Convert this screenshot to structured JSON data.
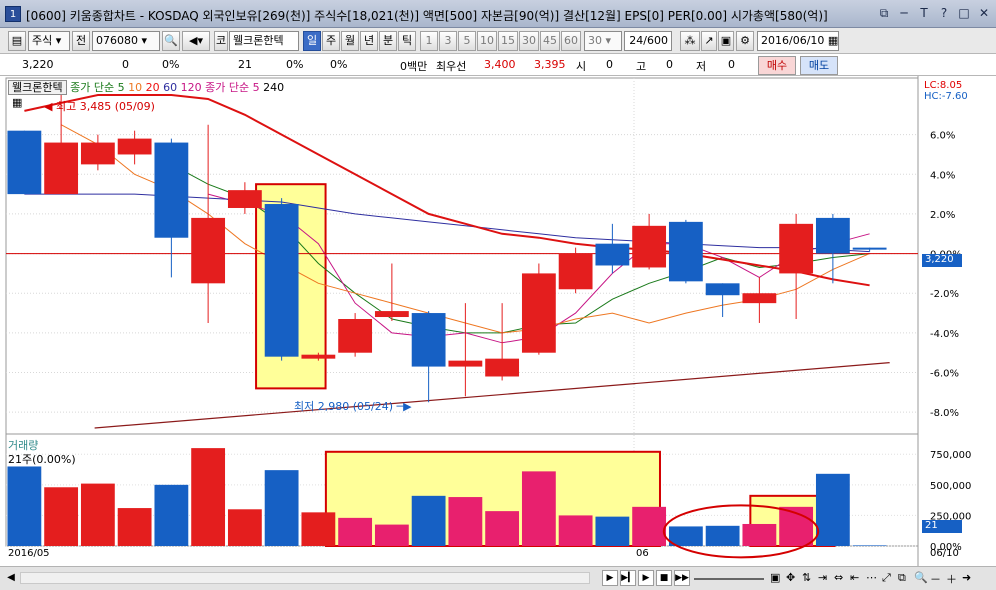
{
  "window": {
    "icon_label": "1",
    "title": "[0600] 키움종합차트 - KOSDAQ 외국인보유[269(천)] 주식수[18,021(천)] 액면[500] 자본금[90(억)] 결산[12월] EPS[0] PER[0.00] 시가총액[580(억)]",
    "sys_icons": [
      "⧉",
      "─",
      "T",
      "?",
      "□",
      "✕"
    ]
  },
  "toolbar": {
    "market": "주식",
    "prev": "전",
    "code": "076080",
    "stock_prefix": "코",
    "stock_name": "웰크론한텍",
    "periods": [
      "일",
      "주",
      "월",
      "년",
      "분",
      "틱"
    ],
    "active_period": "일",
    "minute_options": [
      "1",
      "3",
      "5",
      "10",
      "15",
      "30",
      "45",
      "60"
    ],
    "count_value": "30",
    "paging": "24/600",
    "date": "2016/06/10"
  },
  "inforow": {
    "price": "3,220",
    "change": "0",
    "change_rate": "0%",
    "volume": "21",
    "vol_rate1": "0%",
    "vol_rate2": "0%",
    "unit": "0백만",
    "best_quote_label": "최우선",
    "ask": "3,400",
    "bid": "3,395",
    "open_label": "시",
    "open_val": "0",
    "high_label": "고",
    "high_val": "0",
    "low_label": "저",
    "low_val": "0",
    "buy_label": "매수",
    "sell_label": "매도"
  },
  "chart_legend": {
    "stock": "웰크론한텍",
    "ma_label": "종가 단순",
    "ma_periods": [
      "5",
      "10",
      "20",
      "60",
      "120"
    ],
    "ma2_label": "종가 단순",
    "ma2_periods": [
      "5",
      "240"
    ],
    "lc": "LC:8.05",
    "hc": "HC:-7.60"
  },
  "chart_notes": {
    "high_label": "최고 3,485 (05/09)",
    "low_label": "최저 2,980 (05/24)",
    "price_axis_current": "3,220",
    "volume_title": "거래량",
    "volume_sub": "21주(0.00%)",
    "volume_axis_current": "21",
    "date_start": "2016/05",
    "date_mid": "06",
    "date_end": "06/10"
  },
  "colors": {
    "up": "#e41e1e",
    "up_pink": "#e8206e",
    "down": "#1660c4",
    "highlight": "#ffff99",
    "box_border": "#d40000"
  },
  "chart_data": {
    "type": "candlestick",
    "price_axis": {
      "ticks": [
        "6.0%",
        "4.0%",
        "2.0%",
        "0.00%",
        "-2.0%",
        "-4.0%",
        "-6.0%",
        "-8.0%"
      ],
      "ylim_pct": [
        -9.0,
        8.05
      ]
    },
    "volume_axis": {
      "ticks": [
        "750,000",
        "500,000",
        "250,000",
        "0.00%"
      ]
    },
    "candles_pct": [
      {
        "o": 6.2,
        "c": 3.0,
        "h": 6.2,
        "l": 3.0,
        "dir": "down"
      },
      {
        "o": 3.0,
        "c": 5.6,
        "h": 8.0,
        "l": 3.0,
        "dir": "up"
      },
      {
        "o": 4.5,
        "c": 5.6,
        "h": 6.0,
        "l": 4.2,
        "dir": "up"
      },
      {
        "o": 5.0,
        "c": 5.8,
        "h": 6.2,
        "l": 4.5,
        "dir": "up"
      },
      {
        "o": 5.6,
        "c": 0.8,
        "h": 5.8,
        "l": -1.2,
        "dir": "down"
      },
      {
        "o": -1.5,
        "c": 1.8,
        "h": 6.5,
        "l": -3.5,
        "dir": "up"
      },
      {
        "o": 2.3,
        "c": 3.2,
        "h": 3.6,
        "l": 2.0,
        "dir": "up"
      },
      {
        "o": 2.5,
        "c": -5.2,
        "h": 2.8,
        "l": -5.4,
        "dir": "down"
      },
      {
        "o": -5.3,
        "c": -5.1,
        "h": -5.0,
        "l": -5.4,
        "dir": "up"
      },
      {
        "o": -5.0,
        "c": -3.3,
        "h": -3.0,
        "l": -5.2,
        "dir": "up"
      },
      {
        "o": -3.2,
        "c": -2.9,
        "h": -0.5,
        "l": -3.4,
        "dir": "up"
      },
      {
        "o": -3.0,
        "c": -5.7,
        "h": -2.9,
        "l": -7.5,
        "dir": "down"
      },
      {
        "o": -5.7,
        "c": -5.4,
        "h": -2.5,
        "l": -7.2,
        "dir": "up"
      },
      {
        "o": -6.2,
        "c": -5.3,
        "h": -2.5,
        "l": -6.4,
        "dir": "up"
      },
      {
        "o": -5.0,
        "c": -1.0,
        "h": -0.5,
        "l": -5.1,
        "dir": "up"
      },
      {
        "o": -1.8,
        "c": 0.0,
        "h": 0.3,
        "l": -2.0,
        "dir": "up"
      },
      {
        "o": 0.5,
        "c": -0.6,
        "h": 1.5,
        "l": -1.0,
        "dir": "down"
      },
      {
        "o": -0.7,
        "c": 1.4,
        "h": 2.0,
        "l": -0.8,
        "dir": "up"
      },
      {
        "o": 1.6,
        "c": -1.4,
        "h": 1.7,
        "l": -1.5,
        "dir": "down"
      },
      {
        "o": -1.5,
        "c": -2.1,
        "h": -1.5,
        "l": -3.2,
        "dir": "down"
      },
      {
        "o": -2.0,
        "c": -2.5,
        "h": -1.2,
        "l": -3.5,
        "dir": "up"
      },
      {
        "o": -1.0,
        "c": 1.5,
        "h": 2.0,
        "l": -3.3,
        "dir": "up"
      },
      {
        "o": 1.8,
        "c": 0.0,
        "h": 2.0,
        "l": -1.5,
        "dir": "down"
      },
      {
        "o": 0.2,
        "c": 0.3,
        "h": 0.3,
        "l": 0.1,
        "dir": "down"
      }
    ],
    "volumes": [
      {
        "v": 650000,
        "dir": "down"
      },
      {
        "v": 480000,
        "dir": "up"
      },
      {
        "v": 510000,
        "dir": "up"
      },
      {
        "v": 310000,
        "dir": "up"
      },
      {
        "v": 500000,
        "dir": "down"
      },
      {
        "v": 800000,
        "dir": "up"
      },
      {
        "v": 300000,
        "dir": "up"
      },
      {
        "v": 620000,
        "dir": "down"
      },
      {
        "v": 275000,
        "dir": "up"
      },
      {
        "v": 230000,
        "dir": "pink"
      },
      {
        "v": 175000,
        "dir": "pink"
      },
      {
        "v": 410000,
        "dir": "down"
      },
      {
        "v": 400000,
        "dir": "pink"
      },
      {
        "v": 285000,
        "dir": "pink"
      },
      {
        "v": 610000,
        "dir": "pink"
      },
      {
        "v": 250000,
        "dir": "pink"
      },
      {
        "v": 240000,
        "dir": "down"
      },
      {
        "v": 320000,
        "dir": "pink"
      },
      {
        "v": 160000,
        "dir": "down"
      },
      {
        "v": 165000,
        "dir": "down"
      },
      {
        "v": 180000,
        "dir": "pink"
      },
      {
        "v": 320000,
        "dir": "pink"
      },
      {
        "v": 590000,
        "dir": "down"
      },
      {
        "v": 5000,
        "dir": "down"
      }
    ],
    "ma_lines": [
      {
        "name": "5",
        "color": "#1a7a1a",
        "values": [
          null,
          null,
          null,
          null,
          4.5,
          3.5,
          2.8,
          1.5,
          -0.5,
          -2.0,
          -3.3,
          -3.7,
          -4.0,
          -4.0,
          -3.6,
          -3.5,
          -2.3,
          -1.5,
          -0.9,
          -0.2,
          -0.7,
          -0.5,
          -0.2,
          0.0
        ]
      },
      {
        "name": "10",
        "color": "#c71585",
        "values": [
          null,
          null,
          null,
          null,
          null,
          3.0,
          2.5,
          2.0,
          0.5,
          -2.5,
          -4.0,
          -4.2,
          -4.0,
          -4.5,
          -4.2,
          -3.0,
          -1.0,
          0.5,
          0.5,
          -0.2,
          -1.2,
          0.0,
          0.5,
          1.0
        ]
      },
      {
        "name": "20",
        "color": "#ee7722",
        "values": [
          null,
          6.5,
          5.5,
          4.0,
          3.2,
          2.0,
          0.5,
          -0.5,
          -1.5,
          -2.0,
          -2.5,
          -3.0,
          -3.5,
          -4.0,
          -3.8,
          -3.3,
          -3.0,
          -3.5,
          -3.0,
          -2.6,
          -2.3,
          -1.8,
          -0.8,
          0.0
        ]
      },
      {
        "name": "60",
        "color": "#2f2fa0",
        "values": [
          3.0,
          3.0,
          3.0,
          3.0,
          2.9,
          2.8,
          2.7,
          2.6,
          2.3,
          2.0,
          1.8,
          1.6,
          1.4,
          1.2,
          1.0,
          0.8,
          0.7,
          0.6,
          0.5,
          0.4,
          0.3,
          0.3,
          0.2,
          0.1
        ]
      },
      {
        "name": "120",
        "color": "#dd1111",
        "values": [
          7.2,
          7.6,
          8.0,
          8.0,
          8.0,
          7.8,
          7.0,
          6.0,
          5.0,
          4.0,
          3.0,
          2.0,
          1.5,
          1.0,
          0.8,
          0.5,
          0.3,
          0.2,
          0.0,
          -0.3,
          -0.6,
          -0.9,
          -1.3,
          -1.6
        ]
      }
    ],
    "trendline": {
      "color": "#8b1a1a",
      "from": {
        "i": 3,
        "pct": -8.8
      },
      "to": {
        "i": 23,
        "pct": -5.5
      }
    }
  }
}
